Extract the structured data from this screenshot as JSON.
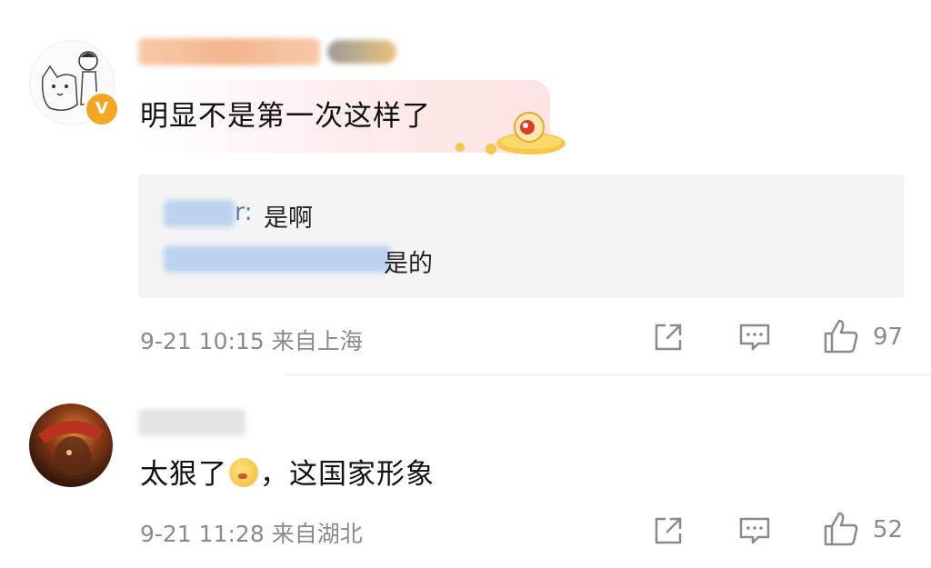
{
  "comments": [
    {
      "text": "明显不是第一次这样了",
      "avatar_badge": "V",
      "replies": [
        {
          "name_suffix": "r:",
          "text": "是啊"
        },
        {
          "text": "是的"
        }
      ],
      "timestamp": "9-21 10:15",
      "location": "来自上海",
      "likes": "97",
      "icons": [
        "share-icon",
        "comment-icon",
        "thumbs-up-icon"
      ]
    },
    {
      "text_before": "太狠了",
      "text_after": "，这国家形象",
      "timestamp": "9-21 11:28",
      "location": "来自湖北",
      "likes": "52",
      "icons": [
        "share-icon",
        "comment-icon",
        "thumbs-up-icon"
      ]
    }
  ],
  "colors": {
    "meta_gray": "#8a8a8a",
    "reply_bg": "#f4f4f4",
    "link_blue": "#5b7fb4",
    "badge_orange": "#f5a623"
  }
}
